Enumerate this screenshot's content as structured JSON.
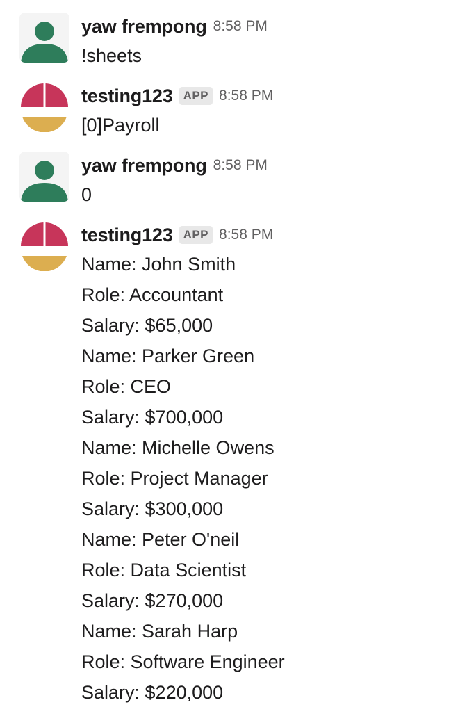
{
  "messages": [
    {
      "author": "yaw frempong",
      "time": "8:58 PM",
      "lines": [
        "!sheets"
      ]
    },
    {
      "author": "testing123",
      "badge": "APP",
      "time": "8:58 PM",
      "lines": [
        "[0]Payroll"
      ]
    },
    {
      "author": "yaw frempong",
      "time": "8:58 PM",
      "lines": [
        "0"
      ]
    },
    {
      "author": "testing123",
      "badge": "APP",
      "time": "8:58 PM",
      "lines": [
        "Name: John Smith",
        "Role: Accountant",
        "Salary: $65,000",
        "Name: Parker Green",
        "Role: CEO",
        "Salary: $700,000",
        "Name: Michelle Owens",
        "Role: Project Manager",
        "Salary: $300,000",
        "Name: Peter O'neil",
        "Role: Data Scientist",
        "Salary: $270,000",
        "Name: Sarah Harp",
        "Role: Software Engineer",
        "Salary: $220,000"
      ]
    }
  ],
  "colors": {
    "user_avatar_fg": "#2e7d5b",
    "user_avatar_bg": "#f4f4f4",
    "app_avatar_top": "#c7355a",
    "app_avatar_bottom": "#dcae50",
    "badge_bg": "#e8e8e8",
    "muted_text": "#616061"
  },
  "icons": {
    "user_avatar": "person-silhouette-icon",
    "app_avatar": "app-logo-icon"
  }
}
